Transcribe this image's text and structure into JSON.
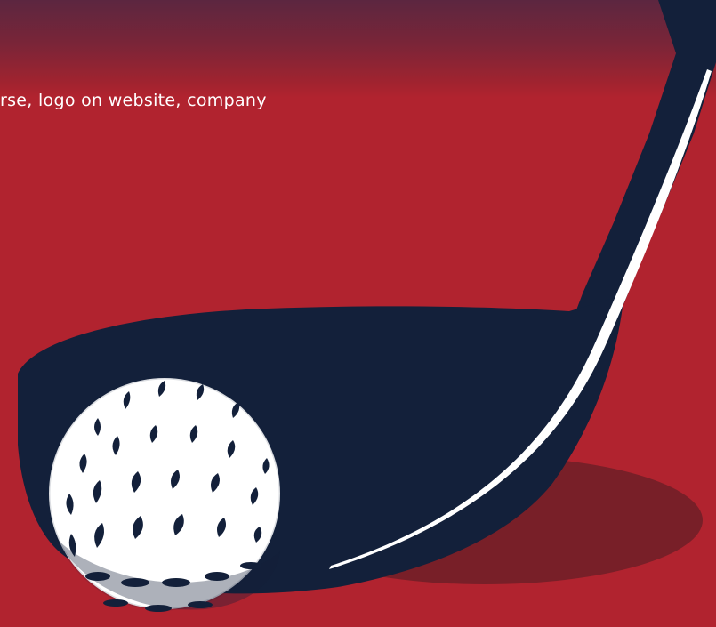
{
  "caption": {
    "text": "rse, logo on website, company"
  },
  "colors": {
    "background": "#b1232f",
    "top_band": "#5c2640",
    "club_head": "#13203a",
    "ball": "#ffffff",
    "shadow": "#6e1f27",
    "highlight": "#ffffff"
  },
  "icons": {
    "club": "golf-club-driver-icon",
    "ball": "golf-ball-icon"
  }
}
